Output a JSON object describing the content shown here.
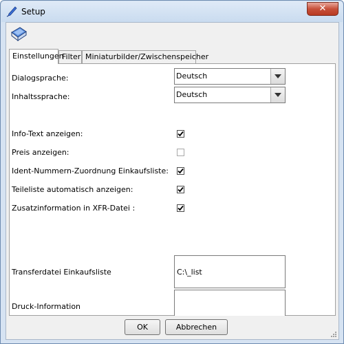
{
  "window": {
    "title": "Setup",
    "close_glyph": "✕"
  },
  "icons": {
    "app": "pen-icon",
    "toolbar": "book-icon"
  },
  "tabs": [
    {
      "label": "Einstellungen",
      "active": true
    },
    {
      "label": "Filter",
      "active": false
    },
    {
      "label": "Miniaturbilder/Zwischenspeicher",
      "active": false
    }
  ],
  "settings": {
    "dialog_language": {
      "label": "Dialogsprache:",
      "value": "Deutsch"
    },
    "content_language": {
      "label": "Inhaltssprache:",
      "value": "Deutsch"
    },
    "checkboxes": [
      {
        "label": "Info-Text anzeigen:",
        "checked": true
      },
      {
        "label": "Preis anzeigen:",
        "checked": false
      },
      {
        "label": "Ident-Nummern-Zuordnung Einkaufsliste:",
        "checked": true
      },
      {
        "label": "Teileliste automatisch anzeigen:",
        "checked": true
      },
      {
        "label": "Zusatzinformation in XFR-Datei :",
        "checked": true
      }
    ],
    "transfer_file": {
      "label": "Transferdatei Einkaufsliste",
      "value": "C:\\_list"
    },
    "print_info": {
      "label": "Druck-Information",
      "value": ""
    }
  },
  "buttons": {
    "ok": "OK",
    "cancel": "Abbrechen"
  },
  "colors": {
    "frame": "#d6e3f2",
    "close": "#c7503a",
    "check": "#000000"
  }
}
